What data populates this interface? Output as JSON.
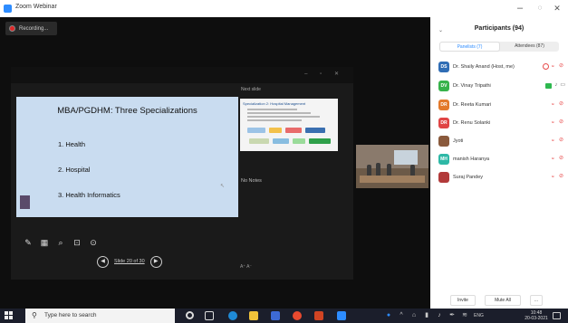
{
  "window": {
    "title": "Zoom Webinar",
    "minimize": "–",
    "maximize": "◌",
    "close": "✕"
  },
  "recording": {
    "label": "Recording..."
  },
  "share": {
    "toolbar": [
      "",
      "",
      ""
    ],
    "elapsed": "",
    "clock": "",
    "next_slide_label": "Next slide",
    "no_notes": "No Notes",
    "font_size_ctrl": "A⁺ A⁻",
    "slide_counter": "Slide 20 of 30"
  },
  "slide": {
    "title": "MBA/PGDHM: Three Specializations",
    "bullets": [
      "1.   Health",
      "2.   Hospital",
      "3.   Health Informatics"
    ],
    "logo_text": ""
  },
  "next_slide": {
    "title": "Specialization 2: Hospital Management"
  },
  "thumbnail": {
    "name": ""
  },
  "panel": {
    "title": "Participants (94)",
    "tabs": [
      "Panelists (7)",
      "Attendees (87)"
    ],
    "participants": [
      {
        "initials": "DS",
        "name": "Dr. Shaily Anand (Host, me)",
        "color": "#2f6db5"
      },
      {
        "initials": "DV",
        "name": "Dr. Vinay Tripathi",
        "color": "#36b24a"
      },
      {
        "initials": "DR",
        "name": "Dr. Reeta Kumari",
        "color": "#e3792b"
      },
      {
        "initials": "DR",
        "name": "Dr. Renu Solanki",
        "color": "#e04545"
      },
      {
        "initials": "",
        "name": "Jyoti",
        "color": "#8a5a3c"
      },
      {
        "initials": "MH",
        "name": "manish Haranya",
        "color": "#2eb8a6"
      },
      {
        "initials": "",
        "name": "Suraj Pandey",
        "color": "#b23a3a"
      }
    ],
    "actions": [
      "Invite",
      "Mute All",
      "..."
    ]
  },
  "taskbar": {
    "search_placeholder": "Type here to search",
    "language": "ENG",
    "time": "10:48",
    "date": "20-03-2021"
  }
}
